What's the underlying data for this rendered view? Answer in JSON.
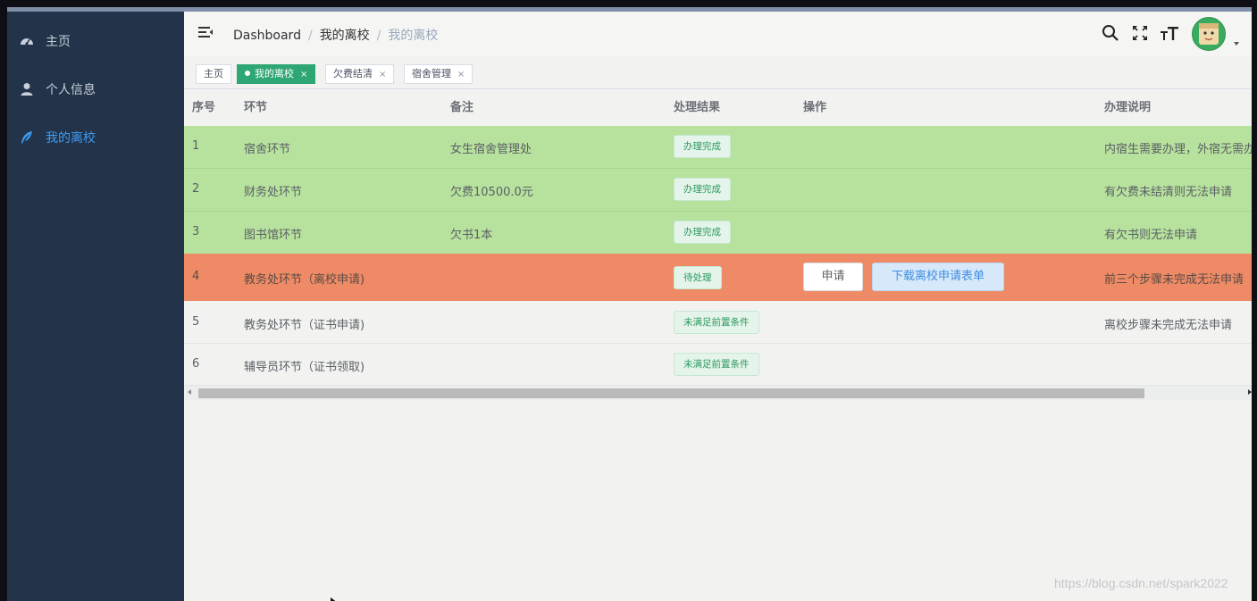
{
  "sidebar": {
    "items": [
      {
        "label": "主页",
        "icon": "dashboard-icon",
        "active": false
      },
      {
        "label": "个人信息",
        "icon": "user-icon",
        "active": false
      },
      {
        "label": "我的离校",
        "icon": "feather-icon",
        "active": true
      }
    ]
  },
  "navbar": {
    "breadcrumb": [
      "Dashboard",
      "我的离校",
      "我的离校"
    ],
    "icons": [
      "search-icon",
      "fullscreen-icon",
      "font-size-icon"
    ]
  },
  "tags": [
    {
      "label": "主页",
      "active": false
    },
    {
      "label": "我的离校",
      "active": true,
      "close": "×"
    },
    {
      "label": "欠费结清",
      "active": false,
      "close": "×"
    },
    {
      "label": "宿舍管理",
      "active": false,
      "close": "×"
    }
  ],
  "table": {
    "headers": [
      "序号",
      "环节",
      "备注",
      "处理结果",
      "操作",
      "办理说明"
    ],
    "rows": [
      {
        "no": "1",
        "step": "宿舍环节",
        "note": "女生宿舍管理处",
        "result": "办理完成",
        "desc": "内宿生需要办理，外宿无需办"
      },
      {
        "no": "2",
        "step": "财务处环节",
        "note": "欠费10500.0元",
        "result": "办理完成",
        "desc": "有欠费未结清则无法申请"
      },
      {
        "no": "3",
        "step": "图书馆环节",
        "note": "欠书1本",
        "result": "办理完成",
        "desc": "有欠书则无法申请"
      },
      {
        "no": "4",
        "step": "教务处环节（离校申请)",
        "note": "",
        "result": "待处理",
        "actions": [
          "申请",
          "下载离校申请表单"
        ],
        "desc": "前三个步骤未完成无法申请"
      },
      {
        "no": "5",
        "step": "教务处环节（证书申请)",
        "note": "",
        "result": "未满足前置条件",
        "desc": "离校步骤未完成无法申请"
      },
      {
        "no": "6",
        "step": "辅导员环节（证书领取)",
        "note": "",
        "result": "未满足前置条件",
        "desc": ""
      }
    ]
  },
  "watermark": "https://blog.csdn.net/spark2022",
  "colors": {
    "sidebar_bg": "#22334a",
    "sidebar_active": "#3f9bf0",
    "row_done": "#b7e29d",
    "row_pending": "#ee8b66",
    "tag_active": "#2ea775",
    "badge_text": "#2e9a5f"
  }
}
